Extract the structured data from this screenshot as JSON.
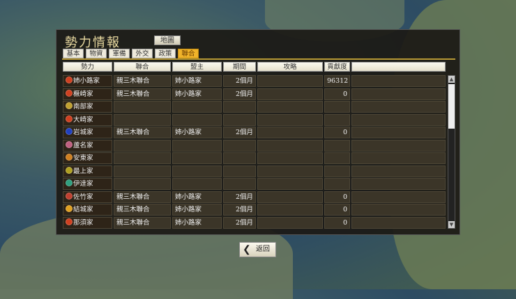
{
  "title": "勢力情報",
  "map_button": "地圖",
  "tabs": [
    {
      "label": "基本"
    },
    {
      "label": "物資"
    },
    {
      "label": "軍備"
    },
    {
      "label": "外交"
    },
    {
      "label": "政策"
    },
    {
      "label": "聯合",
      "active": true
    }
  ],
  "columns": [
    "勢力",
    "聯合",
    "盟主",
    "期間",
    "攻略",
    "貢獻度",
    ""
  ],
  "rows": [
    {
      "clan": "姉小路家",
      "color": "#d04020",
      "union": "親三木聯合",
      "leader": "姉小路家",
      "period": "2個月",
      "capture": "",
      "contrib": "96312"
    },
    {
      "clan": "橛崎家",
      "color": "#d04020",
      "union": "親三木聯合",
      "leader": "姉小路家",
      "period": "2個月",
      "capture": "",
      "contrib": "0"
    },
    {
      "clan": "南部家",
      "color": "#c0a030",
      "union": "",
      "leader": "",
      "period": "",
      "capture": "",
      "contrib": ""
    },
    {
      "clan": "大崎家",
      "color": "#d04020",
      "union": "",
      "leader": "",
      "period": "",
      "capture": "",
      "contrib": ""
    },
    {
      "clan": "岩城家",
      "color": "#2040c0",
      "union": "親三木聯合",
      "leader": "姉小路家",
      "period": "2個月",
      "capture": "",
      "contrib": "0"
    },
    {
      "clan": "蘆名家",
      "color": "#c06080",
      "union": "",
      "leader": "",
      "period": "",
      "capture": "",
      "contrib": ""
    },
    {
      "clan": "安東家",
      "color": "#d08020",
      "union": "",
      "leader": "",
      "period": "",
      "capture": "",
      "contrib": ""
    },
    {
      "clan": "最上家",
      "color": "#b0a020",
      "union": "",
      "leader": "",
      "period": "",
      "capture": "",
      "contrib": ""
    },
    {
      "clan": "伊達家",
      "color": "#30a080",
      "union": "",
      "leader": "",
      "period": "",
      "capture": "",
      "contrib": ""
    },
    {
      "clan": "佐竹家",
      "color": "#c04030",
      "union": "親三木聯合",
      "leader": "姉小路家",
      "period": "2個月",
      "capture": "",
      "contrib": "0"
    },
    {
      "clan": "結城家",
      "color": "#e0a020",
      "union": "親三木聯合",
      "leader": "姉小路家",
      "period": "2個月",
      "capture": "",
      "contrib": "0"
    },
    {
      "clan": "那須家",
      "color": "#d04020",
      "union": "親三木聯合",
      "leader": "姉小路家",
      "period": "2個月",
      "capture": "",
      "contrib": "0"
    }
  ],
  "back_button": "返回"
}
